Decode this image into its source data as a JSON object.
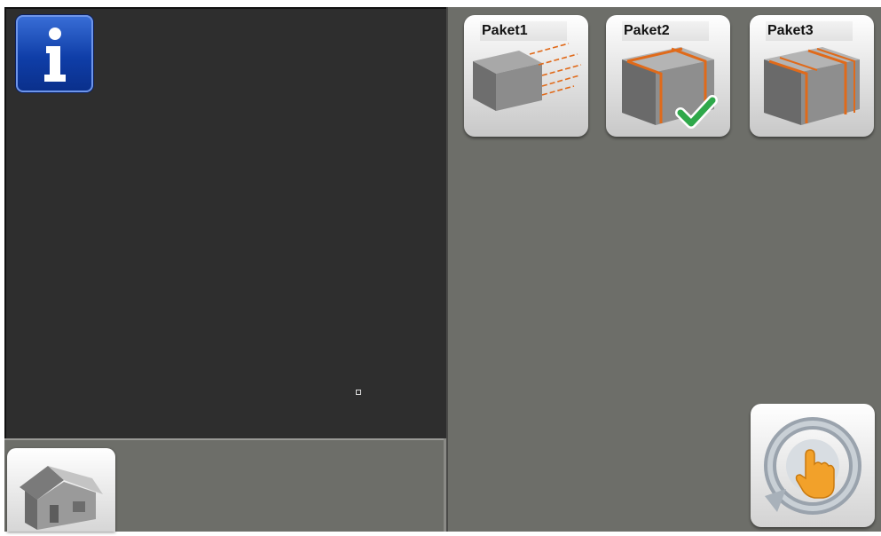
{
  "packages": [
    {
      "label": "Paket1",
      "icon": "package-motion-icon",
      "selected": false
    },
    {
      "label": "Paket2",
      "icon": "package-banded-icon",
      "selected": true
    },
    {
      "label": "Paket3",
      "icon": "package-double-band-icon",
      "selected": false
    }
  ],
  "icons": {
    "info": "info-icon",
    "home": "home-icon",
    "touch": "touch-rotate-icon",
    "check": "check-icon"
  },
  "colors": {
    "dark_panel": "#2e2e2e",
    "gray_panel": "#6d6e69",
    "info_blue": "#0f3ea8",
    "band_orange": "#e06a1a",
    "check_green": "#2ea84a"
  }
}
